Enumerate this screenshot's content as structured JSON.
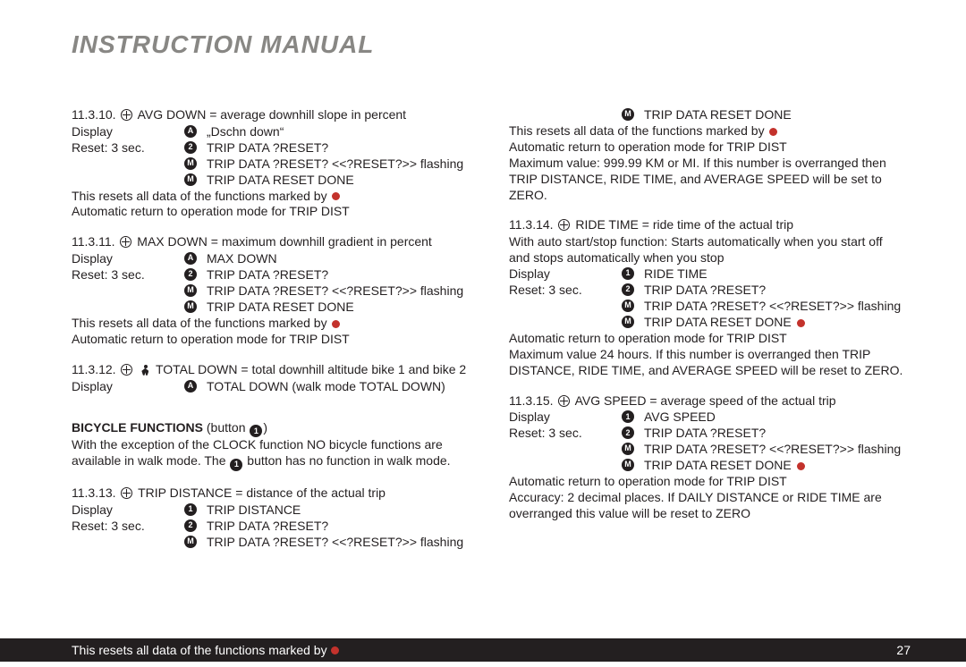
{
  "header": {
    "title": "INSTRUCTION MANUAL"
  },
  "glyphs": {
    "A": "A",
    "M": "M",
    "one": "1",
    "two": "2"
  },
  "left": {
    "s1": {
      "title_pre": "11.3.10. ",
      "title_post": " AVG DOWN = average downhill slope in percent",
      "r1": {
        "label": "Display",
        "sym": "A",
        "val": "„Dschn down“"
      },
      "r2": {
        "label": "Reset:  3 sec.",
        "sym": "two",
        "val": "TRIP DATA ?RESET?"
      },
      "r3": {
        "sym": "M",
        "val": "TRIP DATA ?RESET? <<?RESET?>> flashing"
      },
      "r4": {
        "sym": "M",
        "val": "TRIP DATA RESET DONE"
      },
      "note1": "This resets all data of the functions marked by ",
      "note2": "Automatic return to operation mode for TRIP DIST"
    },
    "s2": {
      "title_pre": "11.3.11. ",
      "title_post": " MAX DOWN = maximum downhill gradient in percent",
      "r1": {
        "label": "Display",
        "sym": "A",
        "val": "MAX DOWN"
      },
      "r2": {
        "label": "Reset:  3 sec.",
        "sym": "two",
        "val": "TRIP DATA ?RESET?"
      },
      "r3": {
        "sym": "M",
        "val": "TRIP DATA ?RESET? <<?RESET?>> flashing"
      },
      "r4": {
        "sym": "M",
        "val": "TRIP DATA RESET DONE"
      },
      "note1": "This resets all data of the functions marked by ",
      "note2": "Automatic return to operation mode for TRIP DIST"
    },
    "s3": {
      "title_pre": "11.3.12. ",
      "title_post": " TOTAL DOWN = total downhill altitude bike 1 and bike 2",
      "r1": {
        "label": "Display",
        "sym": "A",
        "val": "TOTAL DOWN (walk mode TOTAL DOWN)"
      }
    },
    "bf": {
      "heading": "BICYCLE FUNCTIONS ",
      "heading_post": "(button ",
      "heading_end": ")",
      "p1a": "With the exception of the CLOCK function NO bicycle functions are",
      "p1b_pre": "available in walk mode. The ",
      "p1b_post": " button has no function in walk mode."
    },
    "s4": {
      "title_pre": "11.3.13. ",
      "title_post": " TRIP DISTANCE =  distance of the actual trip",
      "r1": {
        "label": "Display",
        "sym": "one",
        "val": "TRIP DISTANCE"
      },
      "r2": {
        "label": "Reset: 3 sec.",
        "sym": "two",
        "val": "TRIP DATA ?RESET?"
      },
      "r3": {
        "sym": "M",
        "val": "TRIP DATA ?RESET? <<?RESET?>> flashing"
      }
    }
  },
  "right": {
    "top": {
      "r1": {
        "sym": "M",
        "val": "TRIP DATA RESET DONE"
      },
      "note1": "This resets all data of the functions marked by ",
      "note2": "Automatic return to operation mode for TRIP DIST",
      "note3": "Maximum value: 999.99 KM or MI. If this number is overranged then",
      "note4": "TRIP DISTANCE, RIDE TIME, and AVERAGE SPEED will be set to ZERO."
    },
    "s5": {
      "title_pre": "11.3.14. ",
      "title_post": " RIDE TIME = ride time of the actual trip",
      "p1": "With auto start/stop function: Starts automatically when you start off",
      "p2": "and stops automatically when you stop",
      "r1": {
        "label": "Display",
        "sym": "one",
        "val": "RIDE TIME"
      },
      "r2": {
        "label": "Reset: 3 sec.",
        "sym": "two",
        "val": "TRIP DATA ?RESET?"
      },
      "r3": {
        "sym": "M",
        "val": "TRIP DATA ?RESET? <<?RESET?>> flashing"
      },
      "r4": {
        "sym": "M",
        "val": "TRIP DATA RESET DONE "
      },
      "note1": "Automatic return to operation mode for TRIP DIST",
      "note2": "Maximum value 24 hours. If this number is overranged then TRIP",
      "note3": "DISTANCE, RIDE TIME, and AVERAGE SPEED will be reset to ZERO."
    },
    "s6": {
      "title_pre": "11.3.15. ",
      "title_post": " AVG SPEED = average speed of the actual trip",
      "r1": {
        "label": "Display",
        "sym": "one",
        "val": "AVG SPEED"
      },
      "r2": {
        "label": "Reset: 3 sec.",
        "sym": "two",
        "val": "TRIP DATA ?RESET?"
      },
      "r3": {
        "sym": "M",
        "val": "TRIP DATA ?RESET? <<?RESET?>> flashing"
      },
      "r4": {
        "sym": "M",
        "val": "TRIP DATA RESET DONE "
      },
      "note1": "Automatic return to operation mode for TRIP DIST",
      "note2": "Accuracy: 2 decimal places. If DAILY DISTANCE or RIDE TIME are",
      "note3": "overranged this value will be reset to ZERO"
    }
  },
  "footer": {
    "text": "This resets all data of the functions marked by ",
    "page": "27"
  }
}
